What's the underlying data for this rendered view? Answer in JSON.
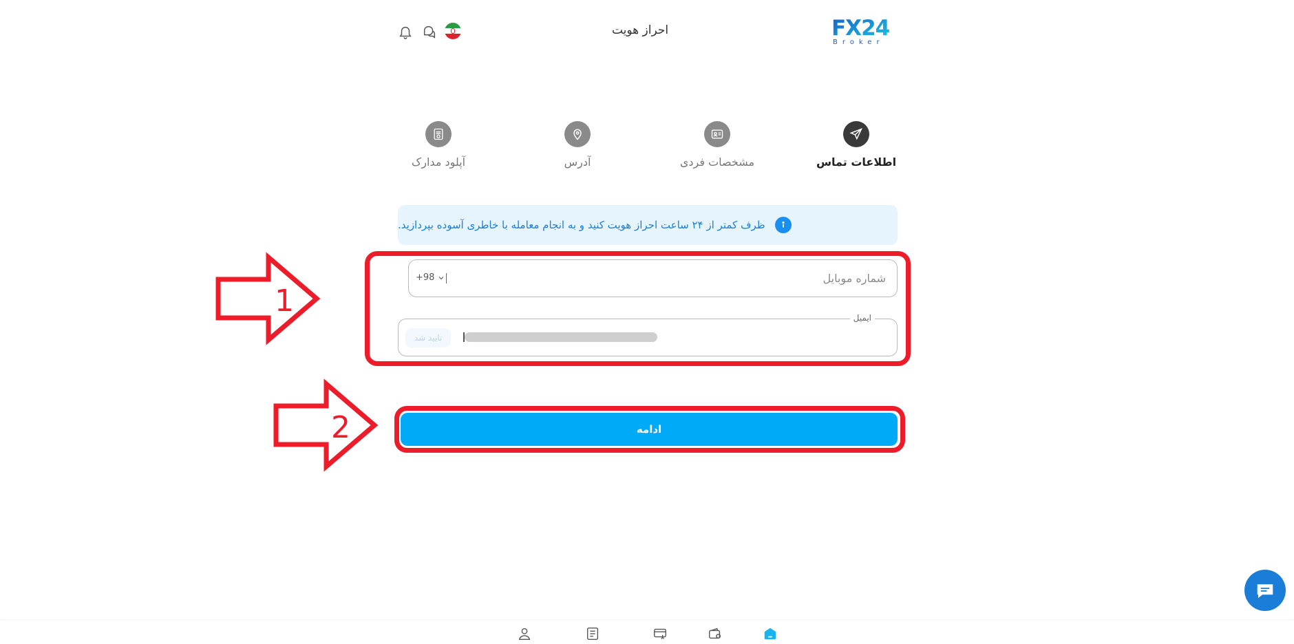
{
  "header": {
    "logo_text": "FX24",
    "logo_sub": "Broker",
    "title": "احراز هویت",
    "icons": [
      "notification-bell-icon",
      "chat-bubbles-icon",
      "iran-flag-icon"
    ]
  },
  "stepper": {
    "steps": [
      {
        "label": "اطلاعات تماس",
        "icon": "send-icon",
        "active": true
      },
      {
        "label": "مشخصات فردی",
        "icon": "id-card-icon",
        "active": false
      },
      {
        "label": "آدرس",
        "icon": "location-pin-icon",
        "active": false
      },
      {
        "label": "آپلود مدارک",
        "icon": "document-upload-icon",
        "active": false
      }
    ]
  },
  "info_banner": {
    "text": "ظرف کمتر از ۲۴ ساعت احراز هویت کنید و به انجام معامله با خاطری آسوده بپردازید.",
    "icon": "info-icon"
  },
  "form": {
    "mobile": {
      "placeholder": "شماره موبایل",
      "country_code": "+98"
    },
    "email": {
      "label": "ایمیل",
      "value": "",
      "verified_badge": "تایید شد"
    },
    "continue_label": "ادامه"
  },
  "annotations": {
    "arrow1_label": "1",
    "arrow2_label": "2",
    "color": "#ec1c2a"
  },
  "colors": {
    "primary": "#00aaf7",
    "info_bg": "#e6f4fd",
    "info_text": "#1a7ed9",
    "active_step": "#3a3a3a",
    "inactive_step": "#8a8a8a"
  },
  "bottom_nav": {
    "items": [
      "home-icon",
      "wallet-icon",
      "card-transfer-icon",
      "transactions-list-icon",
      "profile-icon"
    ]
  },
  "chat_widget": {
    "icon": "chat-fab-icon"
  }
}
